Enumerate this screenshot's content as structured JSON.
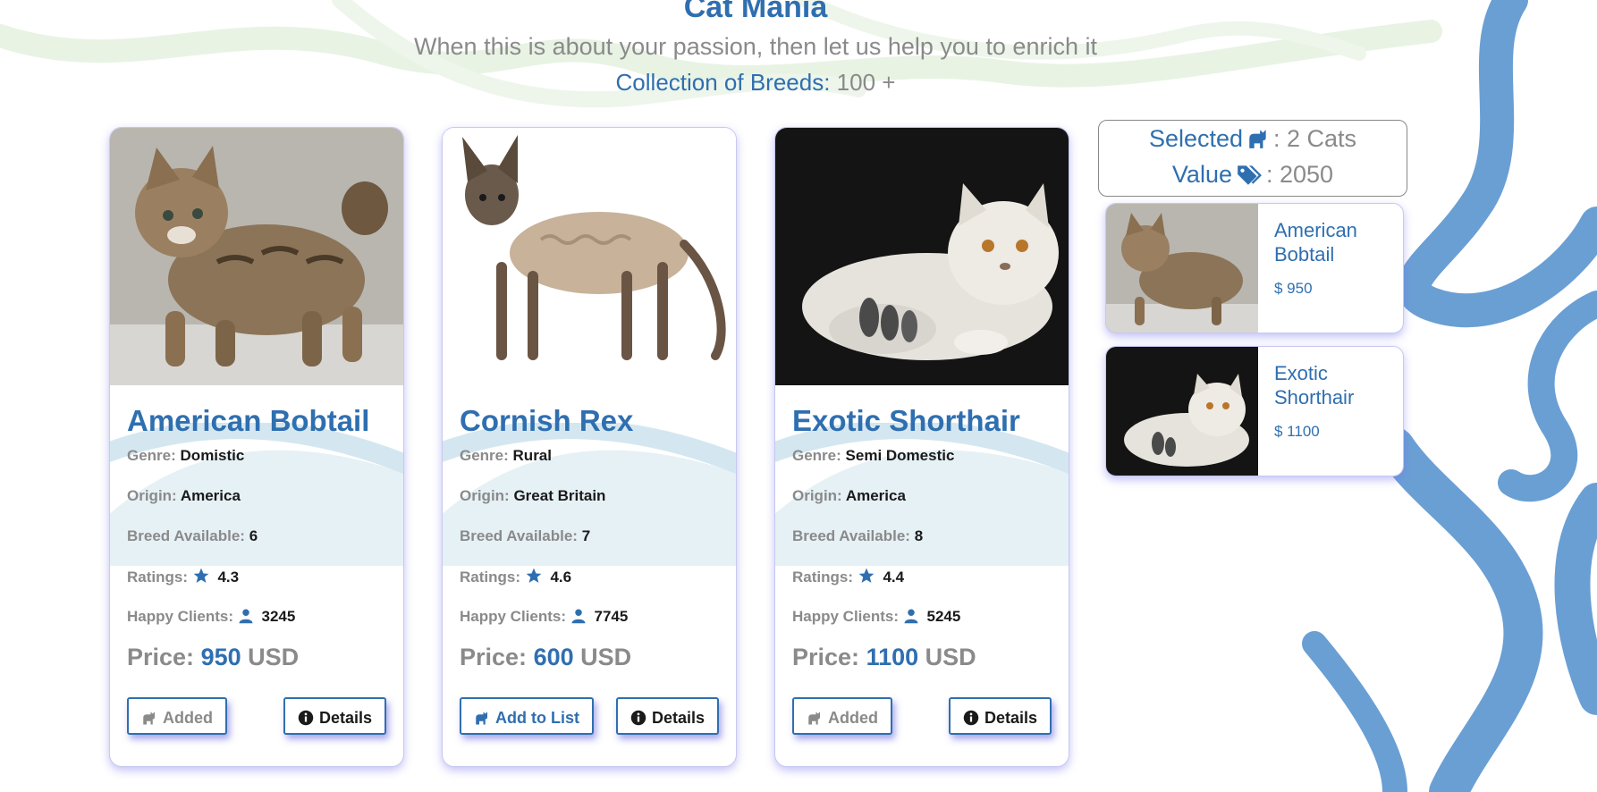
{
  "header": {
    "title": "Cat Mania",
    "tagline": "When this is about your passion, then let us help you to enrich it",
    "collection_label": "Collection of Breeds:",
    "collection_value": "100 +"
  },
  "labels": {
    "genre": "Genre:",
    "origin": "Origin:",
    "breed_available": "Breed Available:",
    "ratings": "Ratings:",
    "happy_clients": "Happy Clients:",
    "price": "Price:",
    "currency": "USD",
    "details_button": "Details",
    "add_button": "Add to List",
    "added_button": "Added"
  },
  "cards": [
    {
      "name": "American Bobtail",
      "genre": "Domistic",
      "origin": "America",
      "breed_available": "6",
      "rating": "4.3",
      "happy_clients": "3245",
      "price": "950",
      "status": "added"
    },
    {
      "name": "Cornish Rex",
      "genre": "Rural",
      "origin": "Great Britain",
      "breed_available": "7",
      "rating": "4.6",
      "happy_clients": "7745",
      "price": "600",
      "status": "add"
    },
    {
      "name": "Exotic Shorthair",
      "genre": "Semi Domestic",
      "origin": "America",
      "breed_available": "8",
      "rating": "4.4",
      "happy_clients": "5245",
      "price": "1100",
      "status": "added"
    }
  ],
  "summary": {
    "selected_label": "Selected",
    "selected_value": ": 2 Cats",
    "value_label": "Value",
    "value_value": ": 2050"
  },
  "selected_items": [
    {
      "name": "American Bobtail",
      "price": "$ 950"
    },
    {
      "name": "Exotic Shorthair",
      "price": "$ 1100"
    }
  ],
  "icons": {
    "cat": "cat-icon",
    "tags": "tags-icon",
    "star": "star-icon",
    "user": "user-icon",
    "info": "info-circle-icon"
  },
  "colors": {
    "accent": "#2f6fb0",
    "muted": "#8a8a8a",
    "swirl_blue": "#6a9fd4",
    "swirl_green": "#e8f3e4",
    "card_glow": "#9a9af0"
  }
}
